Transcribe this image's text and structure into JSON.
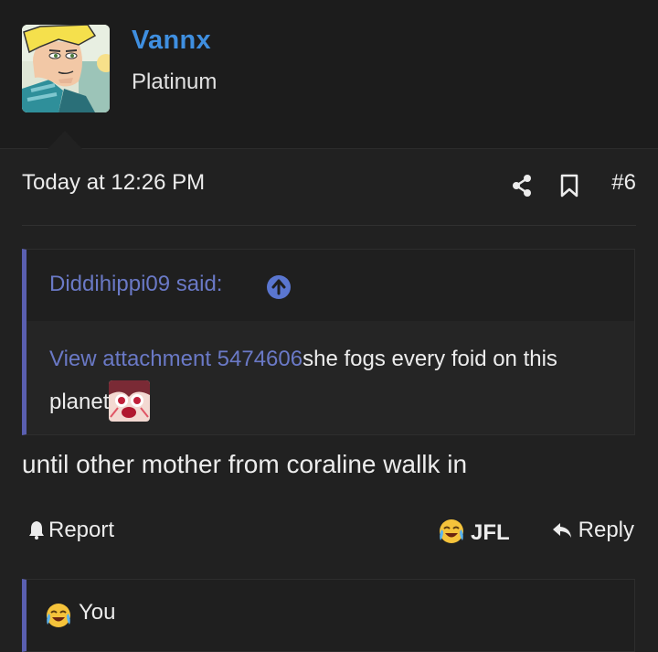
{
  "user": {
    "name": "Vannx",
    "title": "Platinum",
    "avatar_icon": "cartoon-avatar"
  },
  "post": {
    "date": "Today at 12:26 PM",
    "number": "#6",
    "share_icon": "share-icon",
    "bookmark_icon": "bookmark-icon",
    "quote": {
      "author": "Diddihippi09 said:",
      "attachment_link": "View attachment 5474606",
      "text": "she fogs every foid on this planet"
    },
    "body": "until other mother from coraline wallk in"
  },
  "actions": {
    "report": "Report",
    "reaction": "JFL",
    "reply": "Reply"
  },
  "reactions_bar": {
    "who": "You"
  },
  "colors": {
    "background": "#212121",
    "header": "#1c1c1c",
    "username": "#3f8fe0",
    "quote_accent": "#5a5fb0",
    "link": "#6a79c6"
  }
}
